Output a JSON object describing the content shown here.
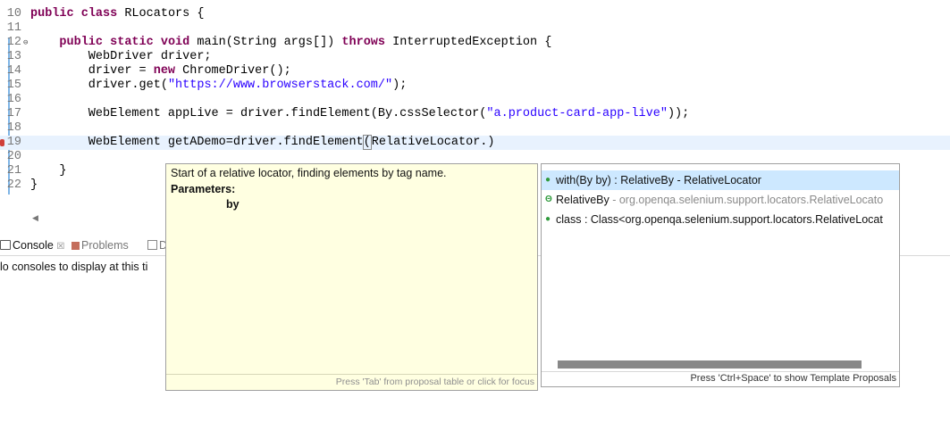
{
  "editor": {
    "lines": [
      {
        "num": "10",
        "tokens": [
          {
            "t": "public",
            "c": "kw"
          },
          {
            "t": " "
          },
          {
            "t": "class",
            "c": "kw"
          },
          {
            "t": " RLocators {"
          }
        ]
      },
      {
        "num": "11",
        "tokens": []
      },
      {
        "num": "12",
        "fold": "⊖",
        "tokens": [
          {
            "t": "    "
          },
          {
            "t": "public",
            "c": "kw"
          },
          {
            "t": " "
          },
          {
            "t": "static",
            "c": "kw"
          },
          {
            "t": " "
          },
          {
            "t": "void",
            "c": "kw"
          },
          {
            "t": " main(String args[]) "
          },
          {
            "t": "throws",
            "c": "kw"
          },
          {
            "t": " InterruptedException {"
          }
        ]
      },
      {
        "num": "13",
        "tokens": [
          {
            "t": "        WebDriver driver;"
          }
        ]
      },
      {
        "num": "14",
        "tokens": [
          {
            "t": "        driver = "
          },
          {
            "t": "new",
            "c": "kw"
          },
          {
            "t": " ChromeDriver();"
          }
        ]
      },
      {
        "num": "15",
        "tokens": [
          {
            "t": "        driver.get("
          },
          {
            "t": "\"https://www.browserstack.com/\"",
            "c": "str"
          },
          {
            "t": ");"
          }
        ]
      },
      {
        "num": "16",
        "tokens": []
      },
      {
        "num": "17",
        "tokens": [
          {
            "t": "        WebElement appLive = driver.findElement(By.cssSelector("
          },
          {
            "t": "\"a.product-card-app-live\"",
            "c": "str"
          },
          {
            "t": "));"
          }
        ]
      },
      {
        "num": "18",
        "tokens": []
      },
      {
        "num": "19",
        "current": true,
        "breakpoint": true,
        "tokens": [
          {
            "t": "        WebElement getADemo=driver.findElement"
          },
          {
            "t": "(",
            "c": "bracket-box"
          },
          {
            "t": "R",
            "c": "caret-box"
          },
          {
            "t": "elativeLocator.)"
          }
        ]
      },
      {
        "num": "20",
        "tokens": []
      },
      {
        "num": "21",
        "tokens": [
          {
            "t": "    }"
          }
        ]
      },
      {
        "num": "22",
        "tokens": [
          {
            "t": "}"
          }
        ]
      }
    ],
    "scroll_arrow": "◀"
  },
  "views": {
    "console_tab": "Console",
    "console_close": "☒",
    "problems_tab": "Problems",
    "third_tab": "D",
    "console_message": "lo consoles to display at this ti"
  },
  "doc_popup": {
    "description": "Start of a relative locator, finding elements by tag name.",
    "params_label": "Parameters:",
    "param_name": "by",
    "hint": "Press 'Tab' from proposal table or click for focus"
  },
  "proposals": {
    "items": [
      {
        "icon": "●",
        "icon_class": "ico-method",
        "main": "with(By by) : RelativeBy - RelativeLocator",
        "qual": "",
        "selected": true
      },
      {
        "icon": "Θ",
        "icon_class": "ico-class",
        "main": "RelativeBy",
        "qual": " - org.openqa.selenium.support.locators.RelativeLocato",
        "selected": false
      },
      {
        "icon": "●",
        "icon_class": "ico-field",
        "main": "class : Class<org.openqa.selenium.support.locators.RelativeLocat",
        "qual": "",
        "selected": false
      }
    ],
    "hint": "Press 'Ctrl+Space' to show Template Proposals"
  }
}
